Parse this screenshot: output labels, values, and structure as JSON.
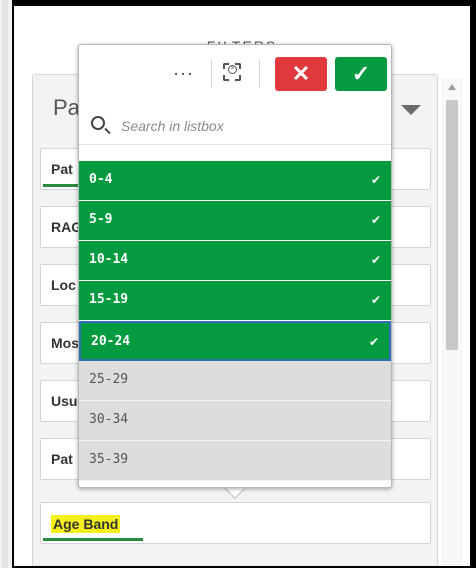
{
  "header": {
    "filters_title": "FILTERS"
  },
  "panel": {
    "title": "Pa",
    "caret_icon": "caret-down-icon"
  },
  "filter_items": [
    {
      "label": "Pat"
    },
    {
      "label": "RAG"
    },
    {
      "label": "Loc"
    },
    {
      "label": "Mos"
    },
    {
      "label": "Usu"
    },
    {
      "label": "Pat"
    },
    {
      "label": "Age Band"
    }
  ],
  "popover": {
    "toolbar": {
      "more_label": "···",
      "clear_icon": "clear-selection-icon",
      "cancel_label": "✕",
      "confirm_label": "✓"
    },
    "search": {
      "placeholder": "Search in listbox"
    },
    "values": [
      {
        "label": "0-4",
        "state": "selected",
        "check": "✔"
      },
      {
        "label": "5-9",
        "state": "selected",
        "check": "✔"
      },
      {
        "label": "10-14",
        "state": "selected",
        "check": "✔"
      },
      {
        "label": "15-19",
        "state": "selected",
        "check": "✔"
      },
      {
        "label": "20-24",
        "state": "selected",
        "check": "✔"
      },
      {
        "label": "25-29",
        "state": "alternative",
        "check": ""
      },
      {
        "label": "30-34",
        "state": "alternative",
        "check": ""
      },
      {
        "label": "35-39",
        "state": "alternative",
        "check": ""
      }
    ]
  },
  "colors": {
    "selected": "#049a3f",
    "cancel": "#e0393e",
    "confirm": "#049a3f",
    "alternative": "#dddddd",
    "highlight": "#f6f01a"
  }
}
